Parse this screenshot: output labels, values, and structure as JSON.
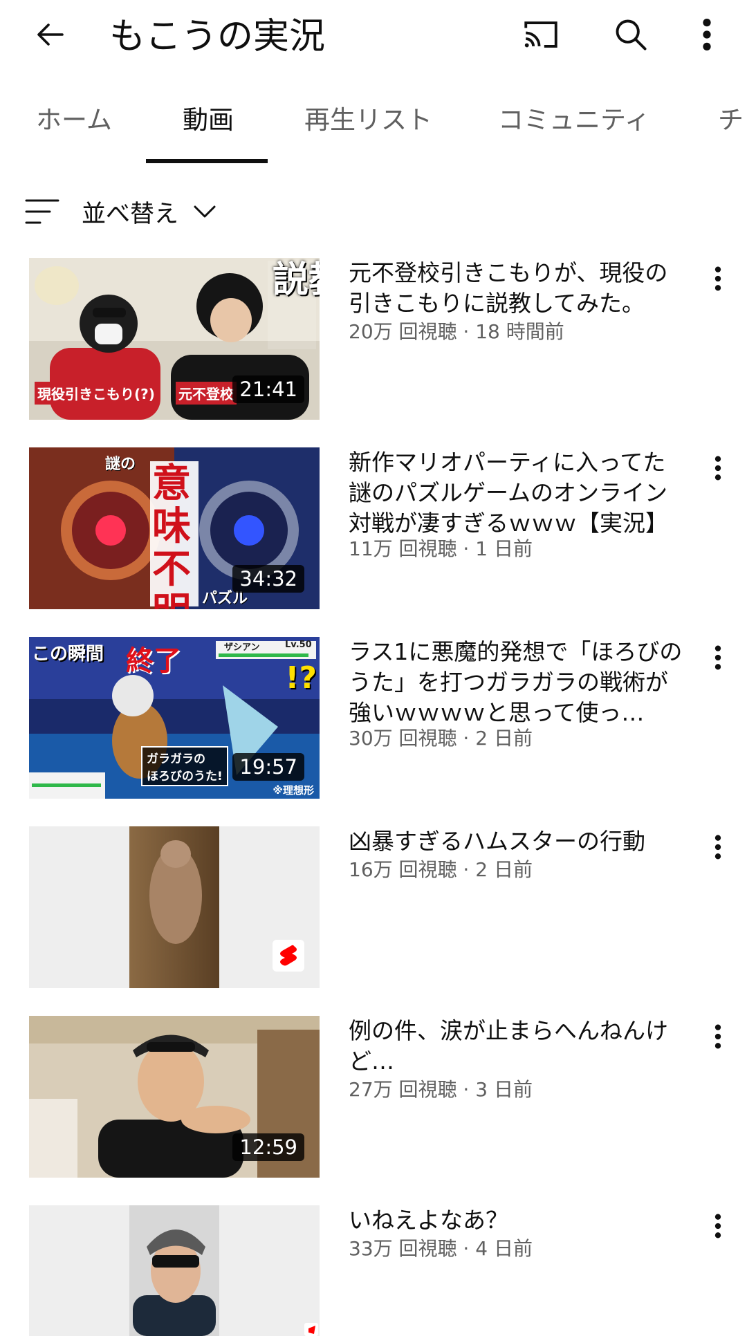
{
  "header": {
    "channel_name": "もこうの実況",
    "icons": {
      "back": "arrow-left-icon",
      "cast": "cast-icon",
      "search": "search-icon",
      "more": "more-vertical-icon"
    }
  },
  "tabs": [
    {
      "label": "ホーム",
      "active": false
    },
    {
      "label": "動画",
      "active": true
    },
    {
      "label": "再生リスト",
      "active": false
    },
    {
      "label": "コミュニティ",
      "active": false
    },
    {
      "label": "チャ",
      "active": false
    }
  ],
  "sort": {
    "label": "並べ替え",
    "icon": "sort-icon"
  },
  "videos": [
    {
      "title": "元不登校引きこもりが、現役の引きこもりに説教してみた。",
      "meta": "20万 回視聴 · 18 時間前",
      "duration": "21:41",
      "thumb_text": [
        "説教",
        "現役引きこもり(?)",
        "元不登校"
      ]
    },
    {
      "title": "新作マリオパーティに入ってた謎のパズルゲームのオンライン対戦が凄すぎるｗｗｗ【実況】",
      "meta": "11万 回視聴 · 1 日前",
      "duration": "34:32",
      "thumb_text": [
        "謎の",
        "意味不明",
        "パズル"
      ]
    },
    {
      "title": "ラス1に悪魔的発想で「ほろびのうた」を打つガラガラの戦術が強いｗｗｗｗと思って使っ…",
      "meta": "30万 回視聴 · 2 日前",
      "duration": "19:57",
      "thumb_text": [
        "この瞬間",
        "終了",
        "!?",
        "ガラガラの",
        "ほろびのうた!",
        "※理想形",
        "ザシアン",
        "Lv.50"
      ]
    },
    {
      "title": "凶暴すぎるハムスターの行動",
      "meta": "16万 回視聴 · 2 日前",
      "duration": "",
      "shorts": true
    },
    {
      "title": "例の件、涙が止まらへんねんけど…",
      "meta": "27万 回視聴 · 3 日前",
      "duration": "12:59"
    },
    {
      "title": "いねえよなあ？",
      "meta": "33万 回視聴 · 4 日前",
      "duration": "",
      "shorts": true
    }
  ],
  "colors": {
    "accent": "#0f0f0f",
    "secondary_text": "#606060",
    "shorts_red": "#ff0000"
  }
}
